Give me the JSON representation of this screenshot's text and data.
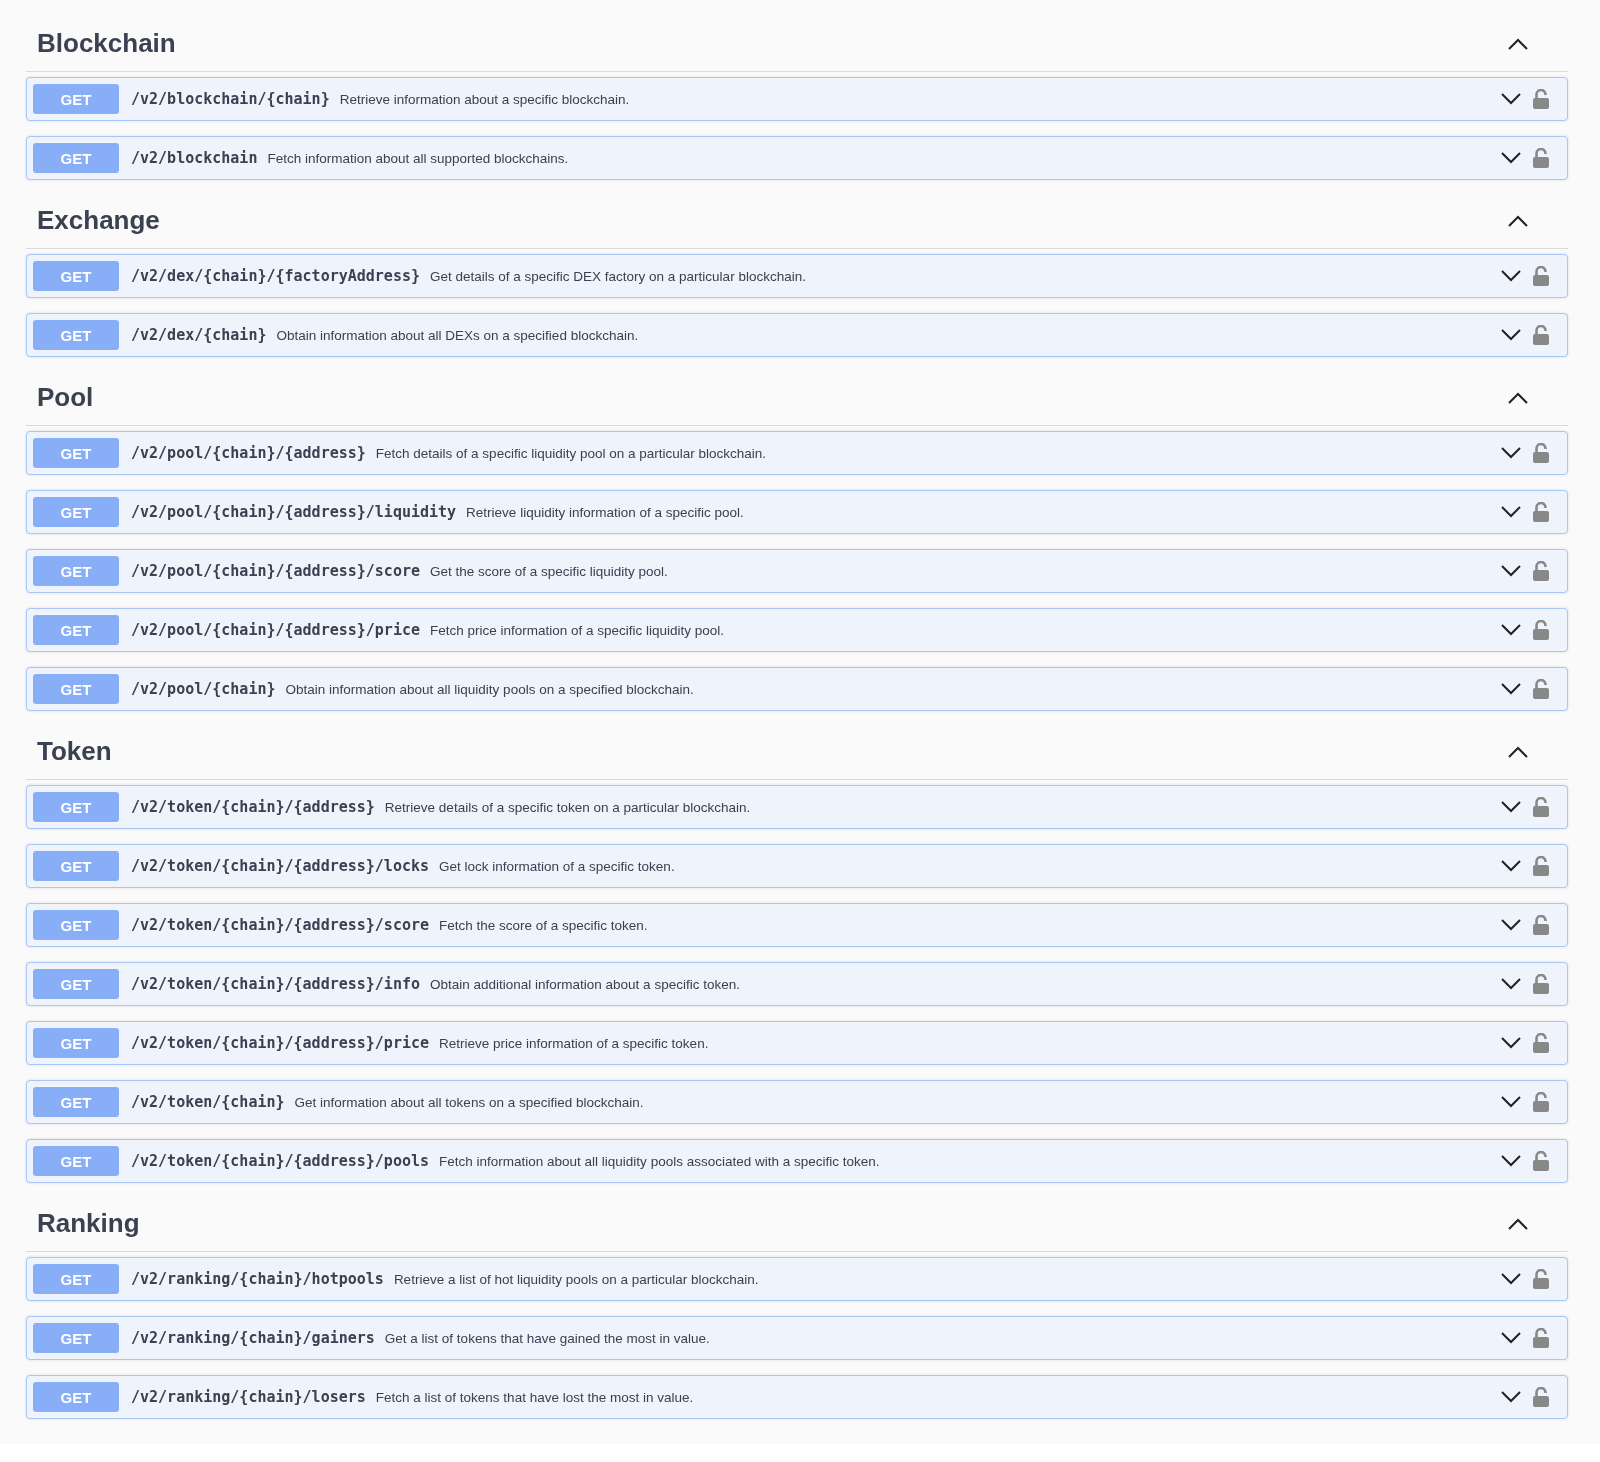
{
  "sections": [
    {
      "title": "Blockchain",
      "expanded": true,
      "operations": [
        {
          "method": "GET",
          "path": "/v2/blockchain/{chain}",
          "summary": "Retrieve information about a specific blockchain.",
          "expanded": false
        },
        {
          "method": "GET",
          "path": "/v2/blockchain",
          "summary": "Fetch information about all supported blockchains.",
          "expanded": false
        }
      ]
    },
    {
      "title": "Exchange",
      "expanded": true,
      "operations": [
        {
          "method": "GET",
          "path": "/v2/dex/{chain}/{factoryAddress}",
          "summary": "Get details of a specific DEX factory on a particular blockchain.",
          "expanded": false
        },
        {
          "method": "GET",
          "path": "/v2/dex/{chain}",
          "summary": "Obtain information about all DEXs on a specified blockchain.",
          "expanded": false
        }
      ]
    },
    {
      "title": "Pool",
      "expanded": true,
      "operations": [
        {
          "method": "GET",
          "path": "/v2/pool/{chain}/{address}",
          "summary": "Fetch details of a specific liquidity pool on a particular blockchain.",
          "expanded": false
        },
        {
          "method": "GET",
          "path": "/v2/pool/{chain}/{address}/liquidity",
          "summary": "Retrieve liquidity information of a specific pool.",
          "expanded": false
        },
        {
          "method": "GET",
          "path": "/v2/pool/{chain}/{address}/score",
          "summary": "Get the score of a specific liquidity pool.",
          "expanded": false
        },
        {
          "method": "GET",
          "path": "/v2/pool/{chain}/{address}/price",
          "summary": "Fetch price information of a specific liquidity pool.",
          "expanded": false
        },
        {
          "method": "GET",
          "path": "/v2/pool/{chain}",
          "summary": "Obtain information about all liquidity pools on a specified blockchain.",
          "expanded": false
        }
      ]
    },
    {
      "title": "Token",
      "expanded": true,
      "operations": [
        {
          "method": "GET",
          "path": "/v2/token/{chain}/{address}",
          "summary": "Retrieve details of a specific token on a particular blockchain.",
          "expanded": false
        },
        {
          "method": "GET",
          "path": "/v2/token/{chain}/{address}/locks",
          "summary": "Get lock information of a specific token.",
          "expanded": false
        },
        {
          "method": "GET",
          "path": "/v2/token/{chain}/{address}/score",
          "summary": "Fetch the score of a specific token.",
          "expanded": false
        },
        {
          "method": "GET",
          "path": "/v2/token/{chain}/{address}/info",
          "summary": "Obtain additional information about a specific token.",
          "expanded": false
        },
        {
          "method": "GET",
          "path": "/v2/token/{chain}/{address}/price",
          "summary": "Retrieve price information of a specific token.",
          "expanded": false
        },
        {
          "method": "GET",
          "path": "/v2/token/{chain}",
          "summary": "Get information about all tokens on a specified blockchain.",
          "expanded": false
        },
        {
          "method": "GET",
          "path": "/v2/token/{chain}/{address}/pools",
          "summary": "Fetch information about all liquidity pools associated with a specific token.",
          "expanded": false
        }
      ]
    },
    {
      "title": "Ranking",
      "expanded": true,
      "operations": [
        {
          "method": "GET",
          "path": "/v2/ranking/{chain}/hotpools",
          "summary": "Retrieve a list of hot liquidity pools on a particular blockchain.",
          "expanded": false
        },
        {
          "method": "GET",
          "path": "/v2/ranking/{chain}/gainers",
          "summary": "Get a list of tokens that have gained the most in value.",
          "expanded": false
        },
        {
          "method": "GET",
          "path": "/v2/ranking/{chain}/losers",
          "summary": "Fetch a list of tokens that have lost the most in value.",
          "expanded": false
        }
      ]
    }
  ]
}
